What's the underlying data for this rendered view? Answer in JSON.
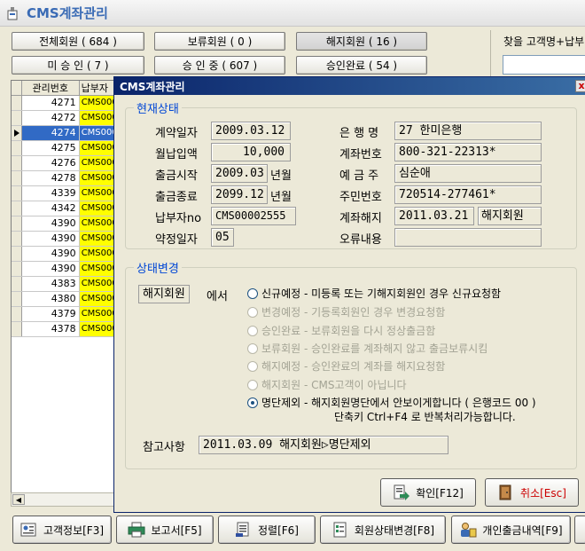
{
  "window": {
    "title": "CMS계좌관리"
  },
  "filters": [
    {
      "label": "전체회원 ( 684 )"
    },
    {
      "label": "보류회원 ( 0 )"
    },
    {
      "label": "해지회원 ( 16 )"
    },
    {
      "label": "미 승 인 ( 7 )"
    },
    {
      "label": "승 인 중 ( 607 )"
    },
    {
      "label": "승인완료 ( 54 )"
    }
  ],
  "search": {
    "label": "찾을 고객명+납부"
  },
  "grid": {
    "columns": [
      "관리번호",
      "납부자"
    ],
    "rows": [
      {
        "id": "4271",
        "code": "CMS000"
      },
      {
        "id": "4272",
        "code": "CMS000"
      },
      {
        "id": "4274",
        "code": "CMS000"
      },
      {
        "id": "4275",
        "code": "CMS000"
      },
      {
        "id": "4276",
        "code": "CMS000"
      },
      {
        "id": "4278",
        "code": "CMS000"
      },
      {
        "id": "4339",
        "code": "CMS000"
      },
      {
        "id": "4342",
        "code": "CMS000"
      },
      {
        "id": "4390",
        "code": "CMS000"
      },
      {
        "id": "4390",
        "code": "CMS000"
      },
      {
        "id": "4390",
        "code": "CMS000"
      },
      {
        "id": "4390",
        "code": "CMS000"
      },
      {
        "id": "4383",
        "code": "CMS000"
      },
      {
        "id": "4380",
        "code": "CMS000"
      },
      {
        "id": "4379",
        "code": "CMS000"
      },
      {
        "id": "4378",
        "code": "CMS000"
      }
    ],
    "selected_index": 2
  },
  "dialog": {
    "title": "CMS계좌관리",
    "close": "x",
    "current": {
      "legend": "현재상태",
      "contract_date_label": "계약일자",
      "contract_date": "2009.03.12",
      "monthly_label": "월납입액",
      "monthly": "10,000",
      "start_label": "출금시작",
      "start": "2009.03",
      "start_unit": "년월",
      "end_label": "출금종료",
      "end": "2099.12",
      "end_unit": "년월",
      "payer_label": "납부자no",
      "payer": "CMS00002555",
      "agree_label": "약정일자",
      "agree": "05",
      "bank_label": "은 행 명",
      "bank": "27 한미은행",
      "account_label": "계좌번호",
      "account": "800-321-22313*",
      "holder_label": "예 금 주",
      "holder": "심순애",
      "rrn_label": "주민번호",
      "rrn": "720514-277461*",
      "cancel_label": "계좌해지",
      "cancel_date": "2011.03.21",
      "cancel_status": "해지회원",
      "error_label": "오류내용",
      "error": ""
    },
    "change": {
      "legend": "상태변경",
      "current_status": "해지회원",
      "from_label": "에서",
      "options": [
        {
          "text": "신규예정 - 미등록 또는 기해지회원인 경우 신규요청함",
          "enabled": true,
          "checked": false
        },
        {
          "text": "변경예정 - 기등록회원인 경우 변경요청함",
          "enabled": false,
          "checked": false
        },
        {
          "text": "승인완료 - 보류회원을 다시 정상출금함",
          "enabled": false,
          "checked": false
        },
        {
          "text": "보류회원 - 승인완료를 계좌해지 않고 출금보류시킴",
          "enabled": false,
          "checked": false
        },
        {
          "text": "해지예정 - 승인완료의 계좌를 해지요청함",
          "enabled": false,
          "checked": false
        },
        {
          "text": "해지회원 - CMS고객이 아닙니다",
          "enabled": false,
          "checked": false
        },
        {
          "text": "명단제외 - 해지회원명단에서 안보이게합니다 ( 은행코드 00 )",
          "text2": "단축키 Ctrl+F4 로 반복처리가능합니다.",
          "enabled": true,
          "checked": true
        }
      ],
      "note_label": "참고사항",
      "note": "2011.03.09 해지회원▷명단제외"
    },
    "ok": "확인[F12]",
    "cancel": "취소[Esc]"
  },
  "toolbar": [
    {
      "label": "고객정보[F3]"
    },
    {
      "label": "보고서[F5]"
    },
    {
      "label": "정렬[F6]"
    },
    {
      "label": "회원상태변경[F8]"
    },
    {
      "label": "개인출금내역[F9]"
    }
  ],
  "colors": {
    "accent": "#0046d5",
    "title_bar": "#0a246a",
    "highlight": "#ffff00",
    "selection": "#316ac5",
    "cancel_text": "#cc0000"
  }
}
